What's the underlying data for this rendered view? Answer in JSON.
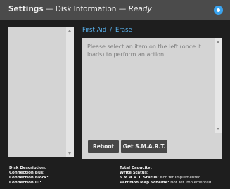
{
  "window": {
    "title_app": "Settings",
    "title_sep": "—",
    "title_section": "Disk Information",
    "title_status": "Ready"
  },
  "tabs": {
    "first_aid": "First Aid",
    "slash": "/",
    "erase": "Erase"
  },
  "main": {
    "message": "Please select an item on the left (once it loads) to perform an action"
  },
  "buttons": {
    "reboot": "Reboot",
    "get_smart": "Get S.M.A.R.T."
  },
  "info_left": [
    {
      "label": "Disk Description:",
      "value": ""
    },
    {
      "label": "Connection Bus:",
      "value": ""
    },
    {
      "label": "Connection Block:",
      "value": ""
    },
    {
      "label": "Connection ID:",
      "value": ""
    }
  ],
  "info_right": [
    {
      "label": "Total Capacity:",
      "value": ""
    },
    {
      "label": "Write Status:",
      "value": ""
    },
    {
      "label": "S.M.A.R.T. Status:",
      "value": "Not Yet Implemented"
    },
    {
      "label": "Partition Map Scheme:",
      "value": "Not Yet Implemented"
    }
  ],
  "colors": {
    "background": "#1e1e1e",
    "titlebar": "#4b4b4b",
    "accent": "#3aa3ee",
    "panel": "#d4d4d4",
    "button": "#474747"
  },
  "icons": {
    "settings": "gear-icon",
    "scroll_up": "arrow-up-icon",
    "scroll_down": "arrow-down-icon"
  }
}
